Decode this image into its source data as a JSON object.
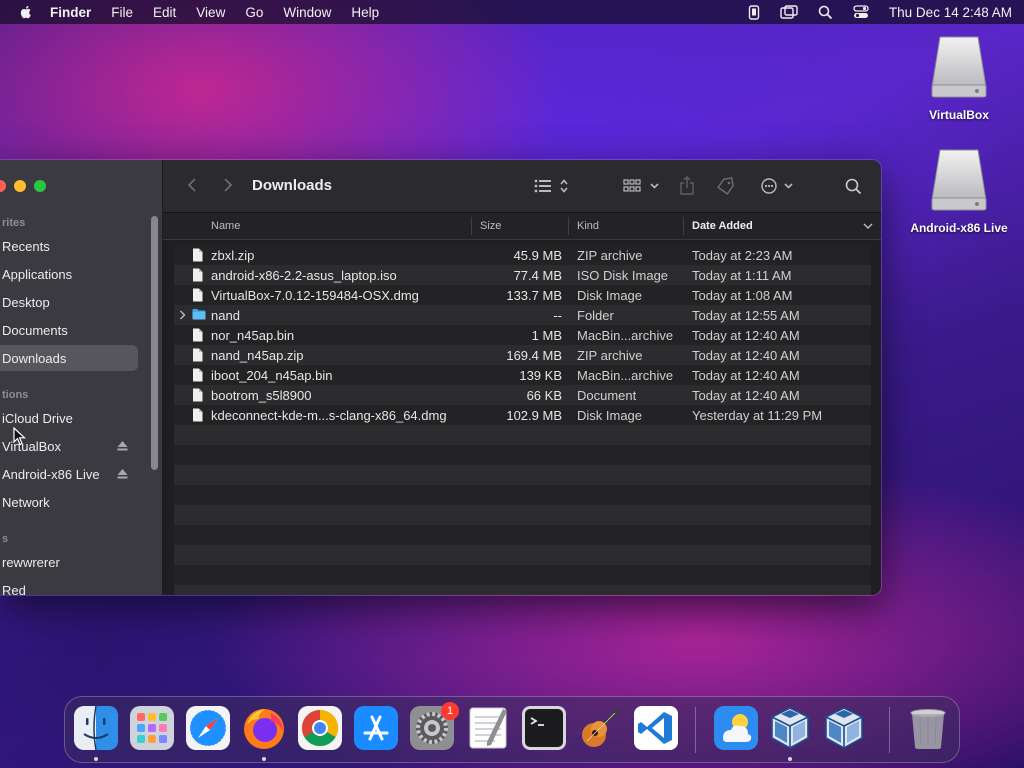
{
  "menubar": {
    "app_name": "Finder",
    "menus": [
      "File",
      "Edit",
      "View",
      "Go",
      "Window",
      "Help"
    ],
    "clock": "Thu Dec 14  2:48 AM"
  },
  "desktop_icons": [
    {
      "label": "VirtualBox"
    },
    {
      "label": "Android-x86 Live"
    }
  ],
  "finder": {
    "title": "Downloads",
    "sidebar": {
      "favorites_header": "rites",
      "favorites": [
        "Recents",
        "Applications",
        "Desktop",
        "Documents",
        "Downloads"
      ],
      "locations_header": "tions",
      "locations": [
        "iCloud Drive",
        "VirtualBox",
        "Android-x86 Live",
        "Network"
      ],
      "tags_header": "s",
      "tags": [
        "rewwrerer",
        "Red"
      ]
    },
    "columns": {
      "name": "Name",
      "size": "Size",
      "kind": "Kind",
      "date": "Date Added"
    },
    "files": [
      {
        "name": "zbxl.zip",
        "size": "45.9 MB",
        "kind": "ZIP archive",
        "date": "Today at 2:23 AM",
        "folder": false
      },
      {
        "name": "android-x86-2.2-asus_laptop.iso",
        "size": "77.4 MB",
        "kind": "ISO Disk Image",
        "date": "Today at 1:11 AM",
        "folder": false
      },
      {
        "name": "VirtualBox-7.0.12-159484-OSX.dmg",
        "size": "133.7 MB",
        "kind": "Disk Image",
        "date": "Today at 1:08 AM",
        "folder": false
      },
      {
        "name": "nand",
        "size": "--",
        "kind": "Folder",
        "date": "Today at 12:55 AM",
        "folder": true
      },
      {
        "name": "nor_n45ap.bin",
        "size": "1 MB",
        "kind": "MacBin...archive",
        "date": "Today at 12:40 AM",
        "folder": false
      },
      {
        "name": "nand_n45ap.zip",
        "size": "169.4 MB",
        "kind": "ZIP archive",
        "date": "Today at 12:40 AM",
        "folder": false
      },
      {
        "name": "iboot_204_n45ap.bin",
        "size": "139 KB",
        "kind": "MacBin...archive",
        "date": "Today at 12:40 AM",
        "folder": false
      },
      {
        "name": "bootrom_s5l8900",
        "size": "66 KB",
        "kind": "Document",
        "date": "Today at 12:40 AM",
        "folder": false
      },
      {
        "name": "kdeconnect-kde-m...s-clang-x86_64.dmg",
        "size": "102.9 MB",
        "kind": "Disk Image",
        "date": "Yesterday at 11:29 PM",
        "folder": false
      }
    ]
  },
  "dock": {
    "apps": [
      "finder-icon",
      "launchpad-icon",
      "safari-icon",
      "firefox-icon",
      "chrome-icon",
      "app-store-icon",
      "system-settings-icon",
      "textedit-icon",
      "terminal-icon",
      "garageband-icon",
      "vscode-icon",
      "weather-icon",
      "virtualbox-icon",
      "virtualbox-vm-icon",
      "trash-icon"
    ],
    "settings_badge": "1"
  }
}
